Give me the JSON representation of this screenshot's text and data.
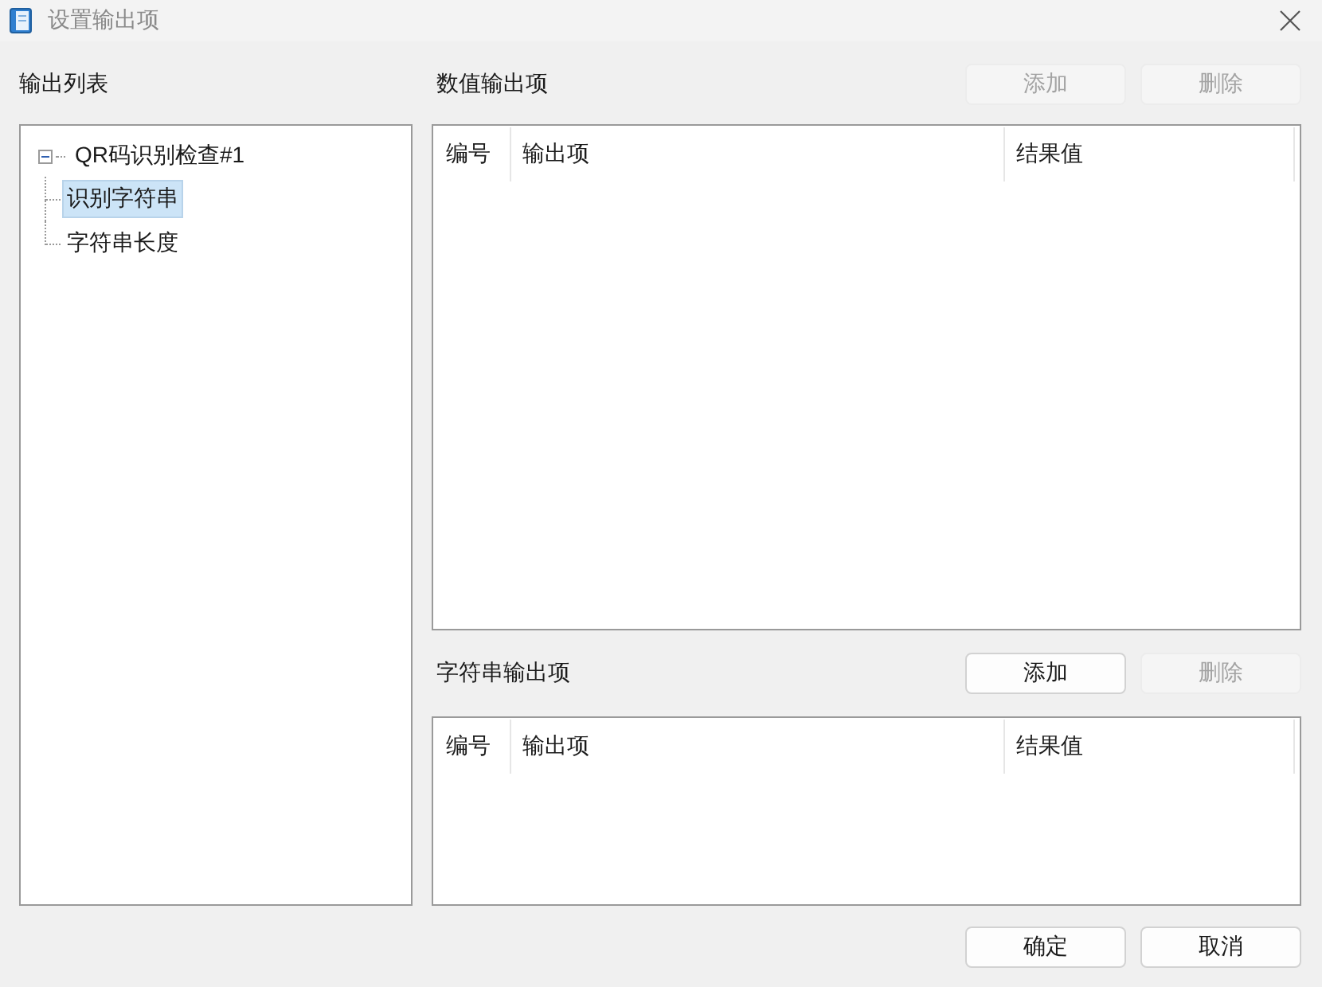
{
  "window": {
    "title": "设置输出项"
  },
  "output_list": {
    "label": "输出列表",
    "tree": [
      {
        "label": "QR码识别检查#1",
        "expanded": true,
        "selected": false,
        "children": [
          {
            "label": "识别字符串",
            "selected": true
          },
          {
            "label": "字符串长度",
            "selected": false
          }
        ]
      }
    ]
  },
  "numeric_outputs": {
    "label": "数值输出项",
    "buttons": [
      {
        "label": "添加",
        "disabled": true
      },
      {
        "label": "删除",
        "disabled": true
      }
    ],
    "table": {
      "columns": [
        "编号",
        "输出项",
        "结果值"
      ]
    }
  },
  "string_outputs": {
    "label": "字符串输出项",
    "buttons": [
      {
        "label": "添加",
        "disabled": false
      },
      {
        "label": "删除",
        "disabled": true
      }
    ],
    "table": {
      "columns": [
        "编号",
        "输出项",
        "结果值"
      ]
    }
  },
  "buttons": [
    {
      "label": "确定"
    },
    {
      "label": "取消"
    }
  ]
}
